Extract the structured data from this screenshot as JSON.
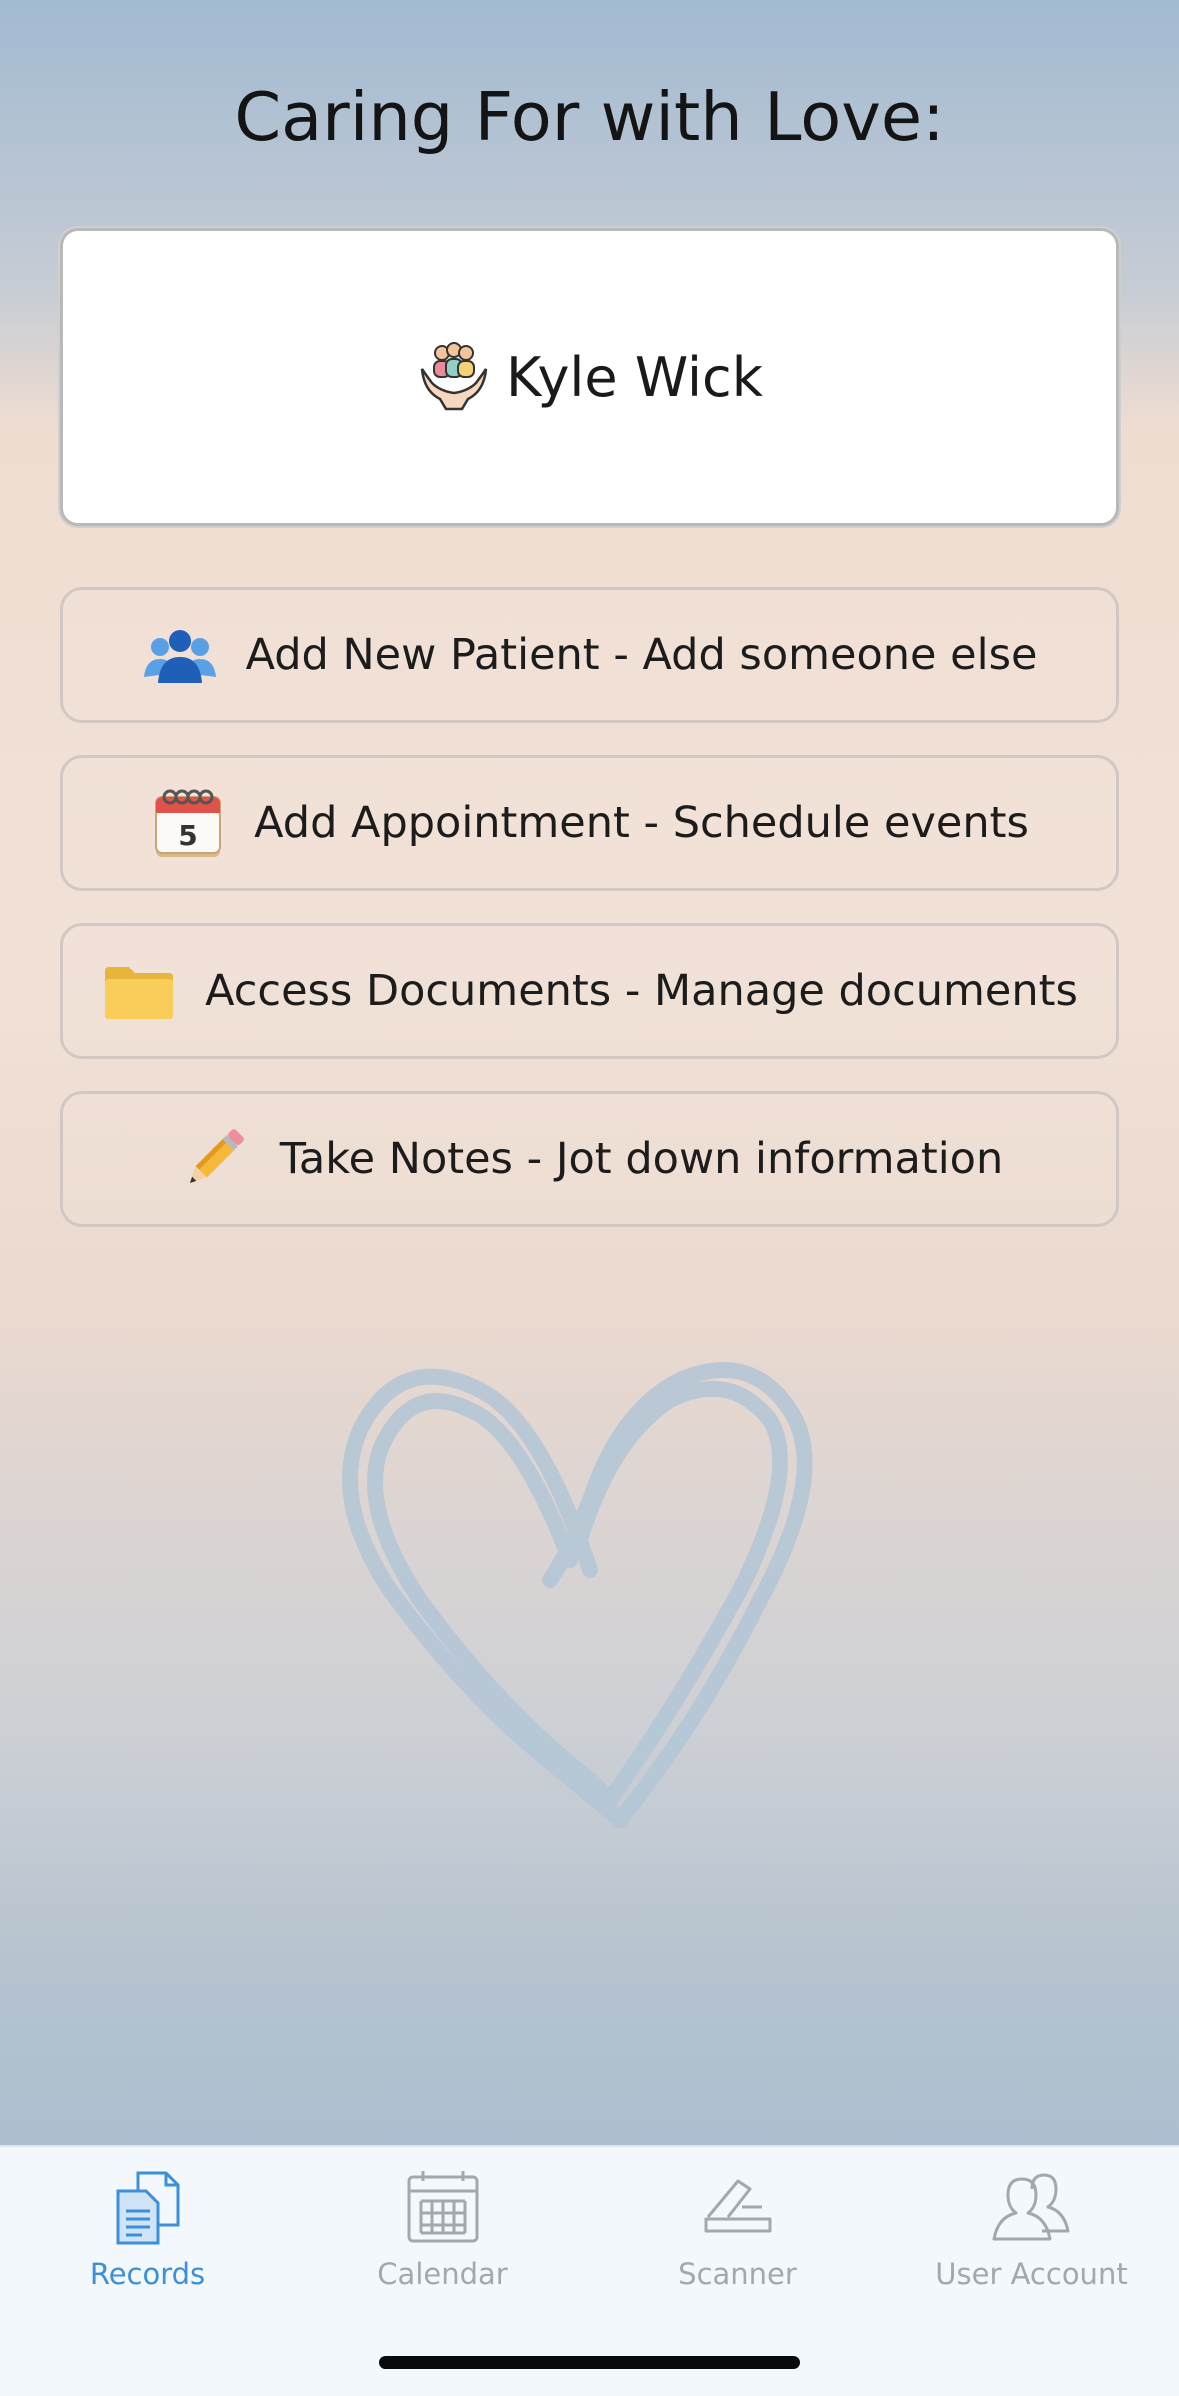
{
  "header": {
    "title": "Caring For with Love:"
  },
  "patient": {
    "name": "Kyle Wick",
    "icon": "caring-hands-icon"
  },
  "actions": [
    {
      "label": "Add New Patient - Add someone else",
      "icon": "people-icon"
    },
    {
      "label": "Add Appointment - Schedule events",
      "icon": "calendar-icon"
    },
    {
      "label": "Access Documents - Manage documents",
      "icon": "folder-icon"
    },
    {
      "label": "Take Notes - Jot down information",
      "icon": "pencil-icon"
    }
  ],
  "tabbar": {
    "tabs": [
      {
        "label": "Records",
        "icon": "records-icon",
        "active": true
      },
      {
        "label": "Calendar",
        "icon": "calendar-tab-icon",
        "active": false
      },
      {
        "label": "Scanner",
        "icon": "scanner-icon",
        "active": false
      },
      {
        "label": "User Account",
        "icon": "user-account-icon",
        "active": false
      }
    ]
  },
  "colors": {
    "accent": "#3d8fd9",
    "inactive_tab": "#a3a8ad",
    "heart": "#b3c6d6"
  }
}
